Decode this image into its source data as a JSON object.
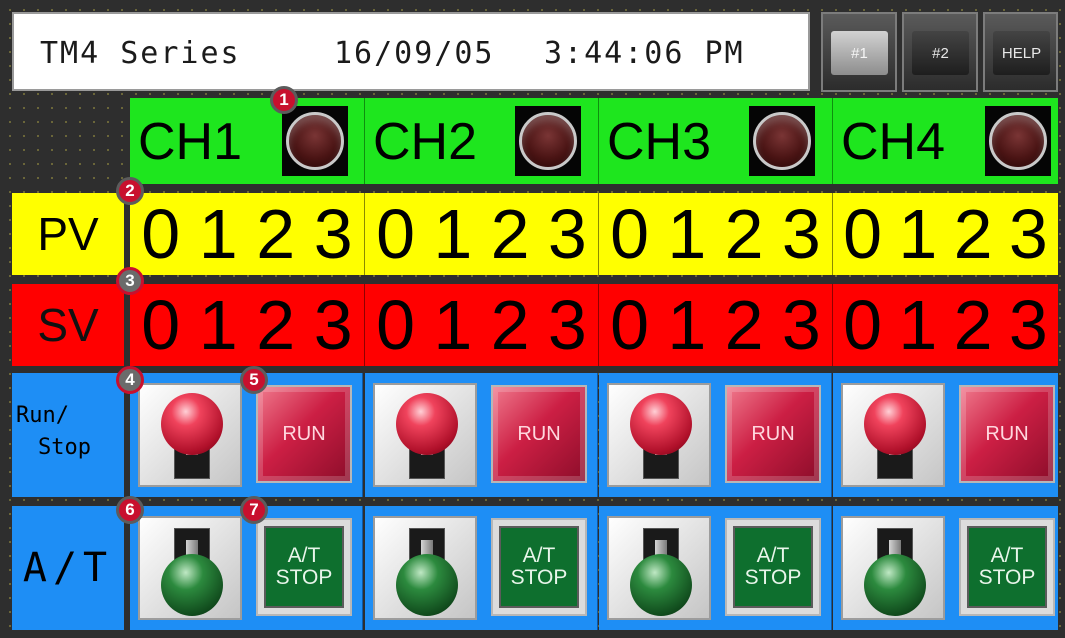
{
  "header": {
    "title": "TM4 Series",
    "date": "16/09/05",
    "time": "3:44:06 PM",
    "buttons": [
      "#1",
      "#2",
      "HELP"
    ]
  },
  "channels": [
    {
      "name": "CH1",
      "pv": [
        "0",
        "1",
        "2",
        "3"
      ],
      "sv": [
        "0",
        "1",
        "2",
        "3"
      ],
      "run_label": "RUN",
      "at_label": "A/T\nSTOP"
    },
    {
      "name": "CH2",
      "pv": [
        "0",
        "1",
        "2",
        "3"
      ],
      "sv": [
        "0",
        "1",
        "2",
        "3"
      ],
      "run_label": "RUN",
      "at_label": "A/T\nSTOP"
    },
    {
      "name": "CH3",
      "pv": [
        "0",
        "1",
        "2",
        "3"
      ],
      "sv": [
        "0",
        "1",
        "2",
        "3"
      ],
      "run_label": "RUN",
      "at_label": "A/T\nSTOP"
    },
    {
      "name": "CH4",
      "pv": [
        "0",
        "1",
        "2",
        "3"
      ],
      "sv": [
        "0",
        "1",
        "2",
        "3"
      ],
      "run_label": "RUN",
      "at_label": "A/T\nSTOP"
    }
  ],
  "row_labels": {
    "pv": "PV",
    "sv": "SV",
    "runstop_line1": "Run/",
    "runstop_line2": "Stop",
    "at": "A/T"
  },
  "markers": [
    "1",
    "2",
    "3",
    "4",
    "5",
    "6",
    "7"
  ],
  "colors": {
    "channel_header": "#1ee61e",
    "pv_row": "#ffff00",
    "sv_row": "#ff0000",
    "control_rows": "#1e8ef5",
    "marker": "#c8102e"
  }
}
